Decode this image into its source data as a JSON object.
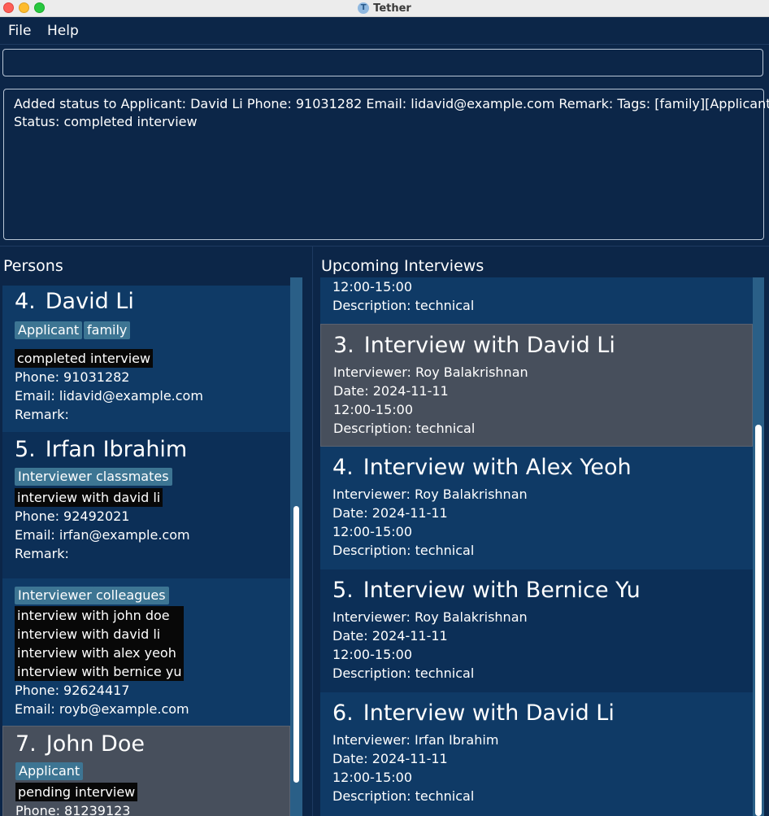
{
  "window": {
    "title": "Tether",
    "icon": "tether-app-icon"
  },
  "menu": {
    "file": "File",
    "help": "Help"
  },
  "command": {
    "value": "",
    "placeholder": ""
  },
  "result": {
    "line1": "Added status to Applicant: David Li Phone: 91031282 Email: lidavid@example.com Remark:  Tags: [family][Applicant]",
    "line2": "Status: completed interview"
  },
  "persons_panel": {
    "title": "Persons",
    "cards": [
      {
        "index": "4.",
        "name": "David Li",
        "tags": [
          "Applicant",
          "family"
        ],
        "statuses": [
          "completed interview"
        ],
        "phone": "Phone: 91031282",
        "email": "Email: lidavid@example.com",
        "remark": "Remark:"
      },
      {
        "index": "5.",
        "name": "Irfan Ibrahim",
        "tags": [
          "Interviewer",
          "classmates"
        ],
        "statuses": [
          "interview with david li"
        ],
        "phone": "Phone: 92492021",
        "email": "Email: irfan@example.com",
        "remark": "Remark:"
      },
      {
        "tags": [
          "Interviewer",
          "colleagues"
        ],
        "statuses": [
          "interview with john doe",
          "interview with david li",
          "interview with alex yeoh",
          "interview with bernice yu"
        ],
        "phone": "Phone: 92624417",
        "email": "Email: royb@example.com"
      },
      {
        "index": "7.",
        "name": "John Doe",
        "tags": [
          "Applicant"
        ],
        "statuses": [
          "pending interview"
        ],
        "phone": "Phone: 81239123"
      }
    ]
  },
  "interviews_panel": {
    "title": "Upcoming Interviews",
    "cards": [
      {
        "time": "12:00-15:00",
        "description": "Description: technical"
      },
      {
        "index": "3.",
        "title": "Interview with David Li",
        "interviewer": "Interviewer: Roy Balakrishnan",
        "date": "Date: 2024-11-11",
        "time": "12:00-15:00",
        "description": "Description: technical"
      },
      {
        "index": "4.",
        "title": "Interview with Alex Yeoh",
        "interviewer": "Interviewer: Roy Balakrishnan",
        "date": "Date: 2024-11-11",
        "time": "12:00-15:00",
        "description": "Description: technical"
      },
      {
        "index": "5.",
        "title": "Interview with Bernice Yu",
        "interviewer": "Interviewer: Roy Balakrishnan",
        "date": "Date: 2024-11-11",
        "time": "12:00-15:00",
        "description": "Description: technical"
      },
      {
        "index": "6.",
        "title": "Interview with David Li",
        "interviewer": "Interviewer: Irfan Ibrahim",
        "date": "Date: 2024-11-11",
        "time": "12:00-15:00",
        "description": "Description: technical"
      }
    ]
  },
  "colors": {
    "background": "#0c2648",
    "card_dark": "#0f3a66",
    "card_alt": "#0c2f57",
    "card_selected": "#474f5c",
    "tag": "#3d7593",
    "status": "#080808"
  }
}
